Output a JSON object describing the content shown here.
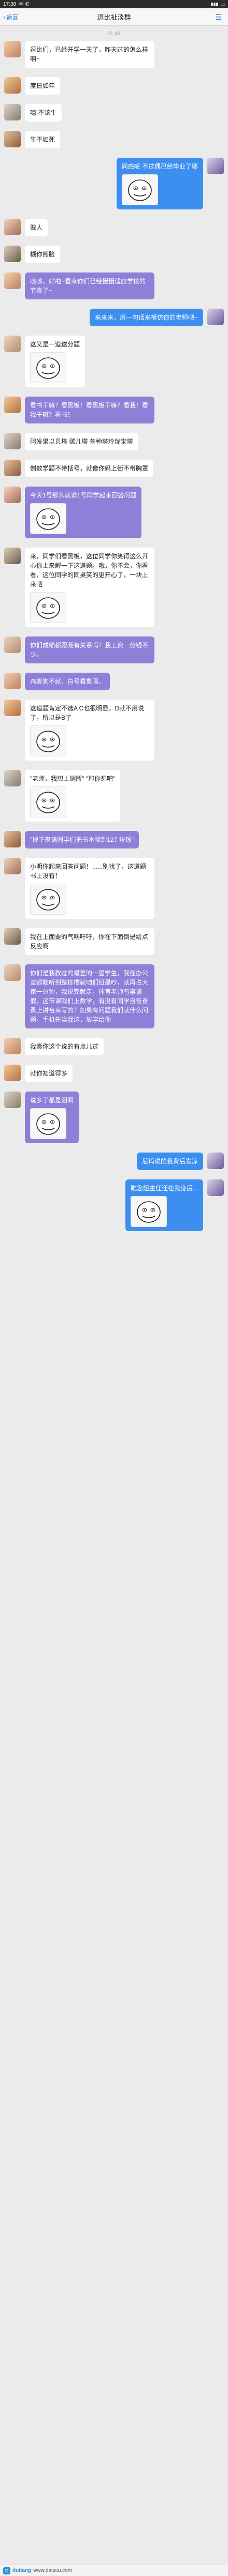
{
  "status_bar": {
    "time": "17:38",
    "battery": ""
  },
  "nav": {
    "back_label": "返回",
    "title": "逗比扯淡群"
  },
  "timestamp": "21:49",
  "messages": [
    {
      "side": "left",
      "avatar": "av1",
      "style": "white",
      "text": "逗比们，已经开学一天了，昨天过的怎么样啊~"
    },
    {
      "side": "left",
      "avatar": "av2",
      "style": "white",
      "text": "度日如年"
    },
    {
      "side": "left",
      "avatar": "av3",
      "style": "white",
      "text": "噫 不该生"
    },
    {
      "side": "left",
      "avatar": "av4",
      "style": "white",
      "text": "生不如死"
    },
    {
      "side": "right",
      "avatar": "av-me",
      "style": "blue",
      "text": "同感呢  不过偶已经毕业了耶"
    },
    {
      "side": "left",
      "avatar": "av5",
      "style": "white",
      "text": "贱人"
    },
    {
      "side": "left",
      "avatar": "av6",
      "style": "white",
      "text": "糊你熊脸"
    },
    {
      "side": "left",
      "avatar": "av1",
      "style": "purple",
      "text": "咳咳，好啦~看来你们已经慢慢适应学校的节奏了~"
    },
    {
      "side": "right",
      "avatar": "av-me",
      "style": "blue",
      "text": "来来来，用一句话来模仿你的老师吧~"
    },
    {
      "side": "left",
      "avatar": "av7",
      "style": "white",
      "text": "这又是一道送分题"
    },
    {
      "side": "left",
      "avatar": "av2",
      "style": "purple",
      "text": "看书干嘛？看黑板！看黑板干嘛？看我！看我干嘛？看书！"
    },
    {
      "side": "left",
      "avatar": "av3",
      "style": "white",
      "text": "阿发果以贝塔 碳儿塔 各种塔玲珑宝塔"
    },
    {
      "side": "left",
      "avatar": "av4",
      "style": "white",
      "text": "倒数学题不带括号，就像你妈上街不带胸罩"
    },
    {
      "side": "left",
      "avatar": "av5",
      "style": "purple",
      "text": "今天1号那么就请1号同学起来回答问题"
    },
    {
      "side": "left",
      "avatar": "av6",
      "style": "white",
      "text": "来，同学们看黑板，这位同学你笑得这么开心你上来解一下这道题。哦，你不会，你看看，这位同学的同桌笑的更开心了，一块上来吧"
    },
    {
      "side": "left",
      "avatar": "av7",
      "style": "purple",
      "text": "你们成绩都跟我有关系吗？我工资一分钱不少。"
    },
    {
      "side": "left",
      "avatar": "av1",
      "style": "purple",
      "text": "鸡麦狗不就，符号看象限。"
    },
    {
      "side": "left",
      "avatar": "av2",
      "style": "white",
      "text": "这道题肯定不选A C也很明显，D就不用说了，所以是B了"
    },
    {
      "side": "left",
      "avatar": "av3",
      "style": "white",
      "text": "\"老师，我想上厕所\" \"那你想吧\""
    },
    {
      "side": "left",
      "avatar": "av4",
      "style": "purple",
      "text": "\"掉下来请同学们把书本翻到127 块钱\""
    },
    {
      "side": "left",
      "avatar": "av5",
      "style": "white",
      "text": "小明你起来回答问题！......别找了，这道题书上没有！"
    },
    {
      "side": "left",
      "avatar": "av6",
      "style": "white",
      "text": "我在上面要的气喘吁吁，你在下面倒是给点反应啊"
    },
    {
      "side": "left",
      "avatar": "av7",
      "style": "purple",
      "text": "你们是我教过的最差的一届学生，我在办公室都能听到整栋楼就咱们班最吵，就再占大家一分钟，我说完就走，体育老师有事请假，这节课我们上数学，有没有同学自告奋勇上讲台来写的？如果有问题我们就什么问题，手机先当我这，放学给你"
    },
    {
      "side": "left",
      "avatar": "av1",
      "style": "white",
      "text": "我奏你这个说的有点儿过"
    },
    {
      "side": "left",
      "avatar": "av2",
      "style": "white",
      "text": "就你知道得多"
    },
    {
      "side": "left",
      "avatar": "av3",
      "style": "purple",
      "text": "说多了都是泪啊"
    },
    {
      "side": "right",
      "avatar": "av-me",
      "style": "blue",
      "text": "尼玛说的我背后发凉"
    },
    {
      "side": "right",
      "avatar": "av-me",
      "style": "blue",
      "text": "瞧您姐主任还在我身后..."
    }
  ],
  "watermark": {
    "icon": "D",
    "text": "duitang",
    "url": "www.daizou.com"
  }
}
